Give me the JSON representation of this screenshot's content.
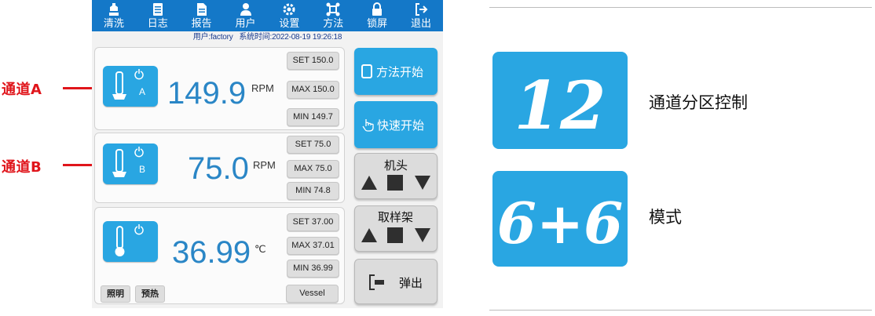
{
  "annotations": {
    "channel_a": "通道A",
    "channel_b": "通道B",
    "color": "#e0151b"
  },
  "topbar": {
    "items": [
      {
        "label": "清洗",
        "icon": "clean-icon"
      },
      {
        "label": "日志",
        "icon": "log-icon"
      },
      {
        "label": "报告",
        "icon": "report-icon"
      },
      {
        "label": "用户",
        "icon": "user-icon"
      },
      {
        "label": "设置",
        "icon": "gear-icon"
      },
      {
        "label": "方法",
        "icon": "method-icon"
      },
      {
        "label": "锁屏",
        "icon": "lock-icon"
      },
      {
        "label": "退出",
        "icon": "exit-icon"
      }
    ]
  },
  "status": {
    "user": "用户:factory",
    "time_label": "系统时间:2022-08-19 19:26:18"
  },
  "channels": [
    {
      "letter": "A",
      "value": "149.9",
      "unit": "RPM",
      "set": "SET 150.0",
      "max": "MAX 150.0",
      "min": "MIN 149.7"
    },
    {
      "letter": "B",
      "value": "75.0",
      "unit": "RPM",
      "set": "SET 75.0",
      "max": "MAX 75.0",
      "min": "MIN 74.8"
    },
    {
      "letter": "",
      "value": "36.99",
      "unit": "℃",
      "set": "SET 37.00",
      "max": "MAX 37.01",
      "min": "MIN 36.99"
    }
  ],
  "bottom_buttons": {
    "light": "照明",
    "preheat": "预热",
    "vessel": "Vessel"
  },
  "right_buttons": {
    "method_start": "方法开始",
    "quick_start": "快速开始",
    "head": "机头",
    "sampler": "取样架",
    "eject": "弹出"
  },
  "features": [
    {
      "tile_text": "12",
      "caption": "通道分区控制"
    },
    {
      "tile_text": "6+6",
      "caption": "模式"
    }
  ],
  "colors": {
    "topbar": "#1478c8",
    "accent": "#29a6e2",
    "value": "#2a86c6"
  }
}
